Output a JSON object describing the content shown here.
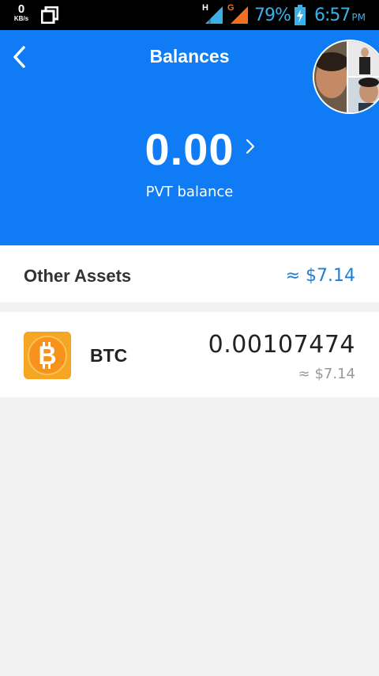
{
  "status_bar": {
    "net_speed_value": "0",
    "net_speed_unit": "KB/s",
    "signal_1_type": "H",
    "signal_2_type": "G",
    "battery": "79%",
    "time": "6:57",
    "ampm": "PM",
    "icons": [
      "window-icon",
      "signal-icon",
      "signal-icon",
      "battery-charging-icon"
    ]
  },
  "header": {
    "title": "Balances",
    "balance": "0.00",
    "balance_label": "PVT balance",
    "background_color": "#0f7cf5"
  },
  "other_assets": {
    "title": "Other Assets",
    "total": "≈ $7.14",
    "accent_color": "#1e7fd8"
  },
  "assets": [
    {
      "symbol": "BTC",
      "amount": "0.00107474",
      "fiat": "≈ $7.14",
      "icon": "bitcoin-icon",
      "icon_color": "#f5a623"
    }
  ]
}
